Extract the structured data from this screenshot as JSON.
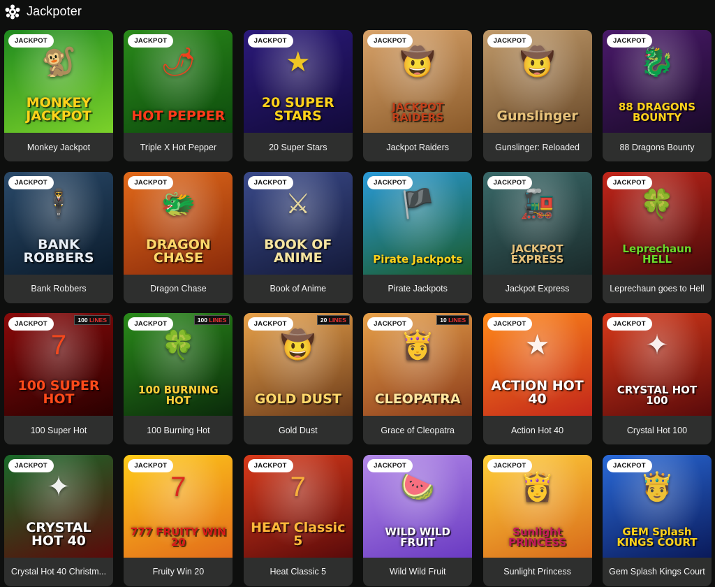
{
  "header": {
    "title": "Jackpoter",
    "icon": "jackpot-logo-icon"
  },
  "badge_label": "JACKPOT",
  "games": [
    {
      "name": "Monkey Jackpot",
      "art": "MONKEY JACKPOT",
      "bg": [
        "#1f8a1f",
        "#7bd12a"
      ],
      "fg": "#ffd21a",
      "deco": "🐒",
      "lines": ""
    },
    {
      "name": "Triple X Hot Pepper",
      "art": "HOT PEPPER",
      "bg": [
        "#2a8a1a",
        "#0d4a0d"
      ],
      "fg": "#ff3a1a",
      "deco": "🌶",
      "lines": ""
    },
    {
      "name": "20 Super Stars",
      "art": "20 SUPER STARS",
      "bg": [
        "#2b1a7a",
        "#120a3a"
      ],
      "fg": "#ffd21a",
      "deco": "★",
      "lines": ""
    },
    {
      "name": "Jackpot Raiders",
      "art": "JACKPOT RAIDERS",
      "bg": [
        "#d8a36a",
        "#8a5a2a"
      ],
      "fg": "#c2401a",
      "deco": "🤠",
      "lines": ""
    },
    {
      "name": "Gunslinger: Reloaded",
      "art": "Gunslinger",
      "bg": [
        "#c09a6a",
        "#6a4a2a"
      ],
      "fg": "#e7c27a",
      "deco": "🤠",
      "lines": ""
    },
    {
      "name": "88 Dragons Bounty",
      "art": "88 DRAGONS BOUNTY",
      "bg": [
        "#4a1a6a",
        "#1a0a2a"
      ],
      "fg": "#ffd21a",
      "deco": "🐉",
      "lines": ""
    },
    {
      "name": "Bank Robbers",
      "art": "BANK ROBBERS",
      "bg": [
        "#2a4a6a",
        "#0a1a2a"
      ],
      "fg": "#e8eef5",
      "deco": "🕴",
      "lines": ""
    },
    {
      "name": "Dragon Chase",
      "art": "DRAGON CHASE",
      "bg": [
        "#e26a1a",
        "#8a2a0a"
      ],
      "fg": "#ffd86a",
      "deco": "🐲",
      "lines": ""
    },
    {
      "name": "Book of Anime",
      "art": "BOOK OF ANIME",
      "bg": [
        "#3a4a8a",
        "#141a3a"
      ],
      "fg": "#f5e4a0",
      "deco": "⚔",
      "lines": ""
    },
    {
      "name": "Pirate Jackpots",
      "art": "Pirate Jackpots",
      "bg": [
        "#2a9ad8",
        "#1a5a2a"
      ],
      "fg": "#ffd21a",
      "deco": "🏴",
      "lines": ""
    },
    {
      "name": "Jackpot Express",
      "art": "JACKPOT EXPRESS",
      "bg": [
        "#3a6a6a",
        "#1a2a2a"
      ],
      "fg": "#e7c27a",
      "deco": "🚂",
      "lines": ""
    },
    {
      "name": "Leprechaun goes to Hell",
      "art": "Leprechaun HELL",
      "bg": [
        "#c2261a",
        "#4a0a0a"
      ],
      "fg": "#6ad82a",
      "deco": "🍀",
      "lines": ""
    },
    {
      "name": "100 Super Hot",
      "art": "100 SUPER HOT",
      "bg": [
        "#8a0a0a",
        "#2a0000"
      ],
      "fg": "#ff4a1a",
      "deco": "7",
      "lines": "100"
    },
    {
      "name": "100 Burning Hot",
      "art": "100 BURNING HOT",
      "bg": [
        "#2a8a1a",
        "#0a2a0a"
      ],
      "fg": "#ffcf3a",
      "deco": "🍀",
      "lines": "100"
    },
    {
      "name": "Gold Dust",
      "art": "GOLD DUST",
      "bg": [
        "#e8a24a",
        "#6a3a1a"
      ],
      "fg": "#ffd86a",
      "deco": "🤠",
      "lines": "20"
    },
    {
      "name": "Grace of Cleopatra",
      "art": "CLEOPATRA",
      "bg": [
        "#e8a24a",
        "#8a3a1a"
      ],
      "fg": "#ffe7a0",
      "deco": "👸",
      "lines": "10"
    },
    {
      "name": "Action Hot 40",
      "art": "ACTION HOT 40",
      "bg": [
        "#ff8a1a",
        "#c2261a"
      ],
      "fg": "#ffffff",
      "deco": "★",
      "lines": ""
    },
    {
      "name": "Crystal Hot 100",
      "art": "CRYSTAL HOT 100",
      "bg": [
        "#d83a1a",
        "#5a0a0a"
      ],
      "fg": "#ffffff",
      "deco": "✦",
      "lines": ""
    },
    {
      "name": "Crystal Hot 40 Christm...",
      "art": "CRYSTAL HOT 40",
      "bg": [
        "#1a6a2a",
        "#5a0a0a"
      ],
      "fg": "#ffffff",
      "deco": "✦",
      "lines": ""
    },
    {
      "name": "Fruity Win 20",
      "art": "777 FRUITY WIN 20",
      "bg": [
        "#ffcc1a",
        "#e26a1a"
      ],
      "fg": "#d81a1a",
      "deco": "7",
      "lines": ""
    },
    {
      "name": "Heat Classic 5",
      "art": "HEAT Classic 5",
      "bg": [
        "#d83a1a",
        "#5a0a0a"
      ],
      "fg": "#ffb83a",
      "deco": "7",
      "lines": ""
    },
    {
      "name": "Wild Wild Fruit",
      "art": "WILD WILD FRUIT",
      "bg": [
        "#b38ae8",
        "#6a3ac2"
      ],
      "fg": "#ffffff",
      "deco": "🍉",
      "lines": ""
    },
    {
      "name": "Sunlight Princess",
      "art": "Sunlight PRINCESS",
      "bg": [
        "#ffcf3a",
        "#d86a1a"
      ],
      "fg": "#c21a5a",
      "deco": "👸",
      "lines": ""
    },
    {
      "name": "Gem Splash Kings Court",
      "art": "GEM Splash KINGS COURT",
      "bg": [
        "#2a6ad8",
        "#0a1a5a"
      ],
      "fg": "#ffd21a",
      "deco": "🤴",
      "lines": ""
    }
  ],
  "colors": {
    "background": "#0e0f0e",
    "card": "#2e2f2e",
    "badge_bg": "#ffffff",
    "badge_text": "#111111"
  }
}
